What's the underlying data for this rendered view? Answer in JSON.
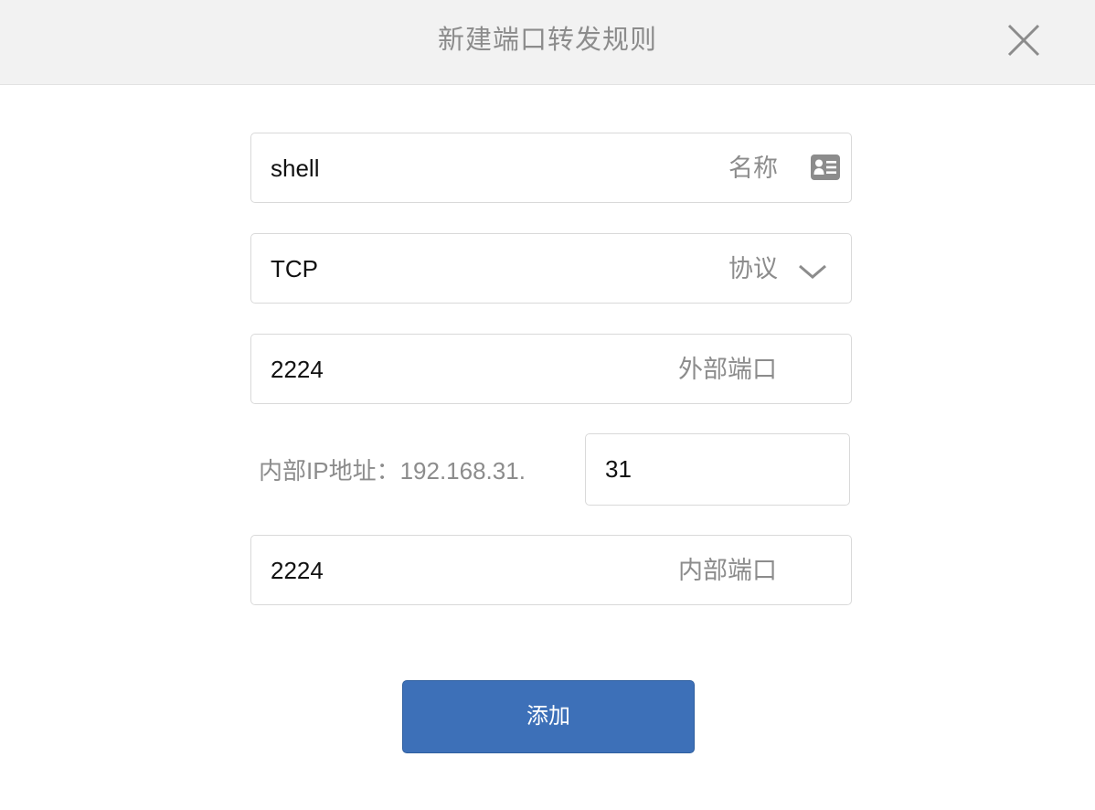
{
  "dialog": {
    "title": "新建端口转发规则",
    "close_icon": "close-icon"
  },
  "form": {
    "name": {
      "value": "shell",
      "label": "名称",
      "icon": "id-card-icon"
    },
    "protocol": {
      "value": "TCP",
      "label": "协议",
      "icon": "chevron-down-icon"
    },
    "external_port": {
      "value": "2224",
      "label": "外部端口"
    },
    "internal_ip": {
      "prefix_label": "内部IP地址：192.168.31.",
      "suffix_value": "31"
    },
    "internal_port": {
      "value": "2224",
      "label": "内部端口"
    },
    "submit_label": "添加"
  },
  "colors": {
    "header_bg": "#f2f2f2",
    "primary_button": "#3d70b8",
    "label_gray": "#8c8c8c",
    "border": "#d9d9d9"
  }
}
